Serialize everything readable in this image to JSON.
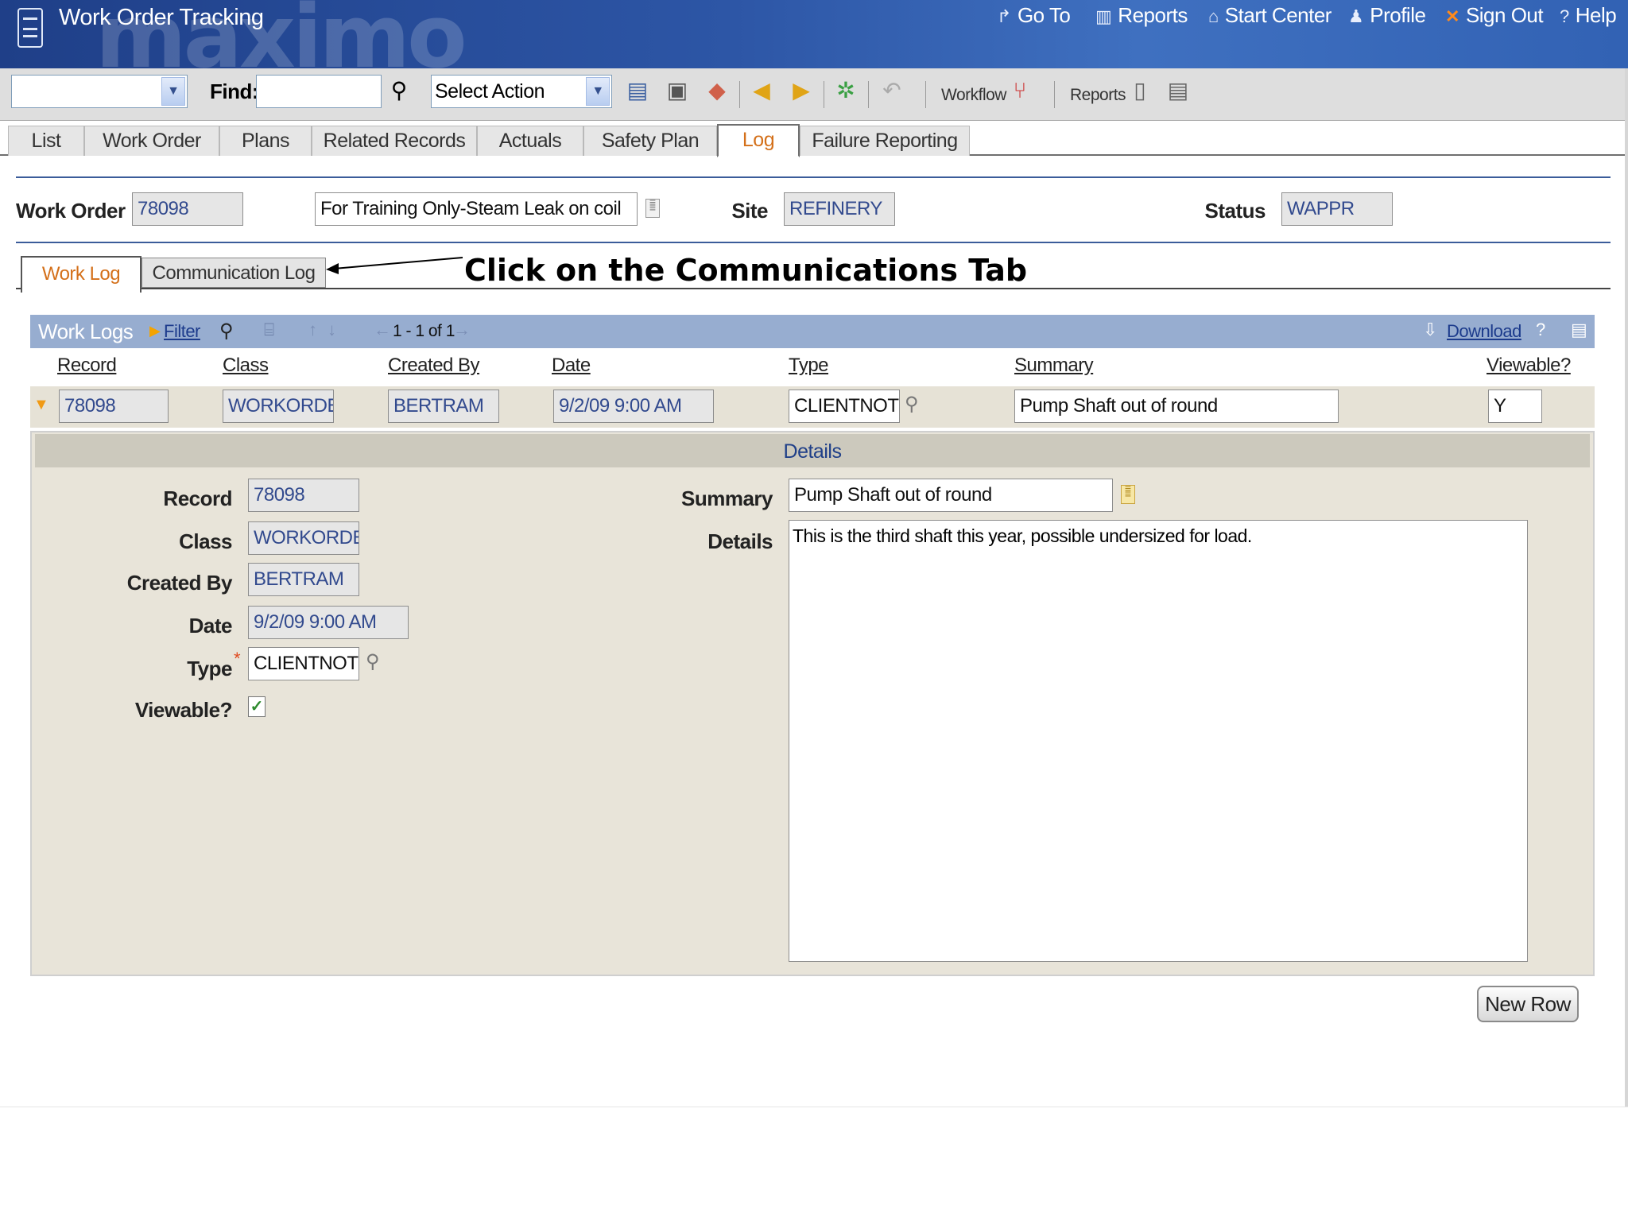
{
  "header": {
    "app_title": "Work Order Tracking",
    "brand": "maximo",
    "links": [
      {
        "label": "Go To",
        "icon": "go-to-icon"
      },
      {
        "label": "Reports",
        "icon": "reports-icon"
      },
      {
        "label": "Start Center",
        "icon": "home-icon"
      },
      {
        "label": "Profile",
        "icon": "profile-icon"
      },
      {
        "label": "Sign Out",
        "icon": "sign-out-icon"
      },
      {
        "label": "Help",
        "icon": "help-icon"
      }
    ]
  },
  "toolbar": {
    "find_label": "Find:",
    "find_value": "",
    "select_action": "Select Action",
    "workflow_label": "Workflow",
    "reports_label": "Reports"
  },
  "tabs": [
    "List",
    "Work Order",
    "Plans",
    "Related Records",
    "Actuals",
    "Safety Plan",
    "Log",
    "Failure Reporting"
  ],
  "active_tab": "Log",
  "work_order": {
    "label": "Work Order",
    "number": "78098",
    "description": "For Training Only-Steam Leak on coil",
    "site_label": "Site",
    "site": "REFINERY",
    "status_label": "Status",
    "status": "WAPPR"
  },
  "subtabs": [
    "Work Log",
    "Communication Log"
  ],
  "annotation": "Click on the Communications Tab",
  "work_logs": {
    "title": "Work Logs",
    "filter_label": "Filter",
    "pagination": "1 - 1 of 1",
    "download_label": "Download",
    "columns": [
      "Record",
      "Class",
      "Created By",
      "Date",
      "Type",
      "Summary",
      "Viewable?"
    ],
    "row": {
      "record": "78098",
      "class": "WORKORDER",
      "created_by": "BERTRAM",
      "date": "9/2/09 9:00 AM",
      "type": "CLIENTNOTE",
      "summary": "Pump Shaft out of round",
      "viewable": "Y"
    }
  },
  "details": {
    "title": "Details",
    "record_label": "Record",
    "record": "78098",
    "class_label": "Class",
    "class": "WORKORDER",
    "created_by_label": "Created By",
    "created_by": "BERTRAM",
    "date_label": "Date",
    "date": "9/2/09 9:00 AM",
    "type_label": "Type",
    "required_mark": "*",
    "type": "CLIENTNOTE",
    "viewable_label": "Viewable?",
    "viewable_checked": true,
    "summary_label": "Summary",
    "summary": "Pump Shaft out of round",
    "details_label": "Details",
    "details_text": "This is the third shaft this year, possible undersized for load."
  },
  "new_row_button": "New Row"
}
